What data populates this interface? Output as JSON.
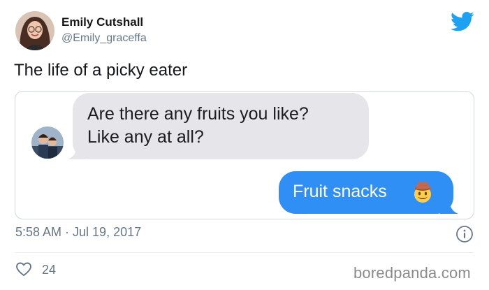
{
  "author": {
    "name": "Emily Cutshall",
    "handle": "@Emily_graceffa"
  },
  "tweet": {
    "text": "The life of a picky eater"
  },
  "conversation": {
    "received_message": "Are there any fruits you like?\nLike any at all?",
    "sent_message": "Fruit snacks",
    "sent_emoji": "cowboy-face-emoji"
  },
  "meta": {
    "timestamp": "5:58 AM · Jul 19, 2017",
    "like_count": "24"
  },
  "watermark": "boredpanda.com",
  "icons": {
    "brand": "twitter-bird-icon",
    "info": "info-icon",
    "like": "heart-icon"
  },
  "colors": {
    "twitter_blue": "#1da1f2",
    "imessage_blue": "#2f8ff5",
    "imessage_gray": "#e5e5ea",
    "secondary_text": "#657786"
  }
}
